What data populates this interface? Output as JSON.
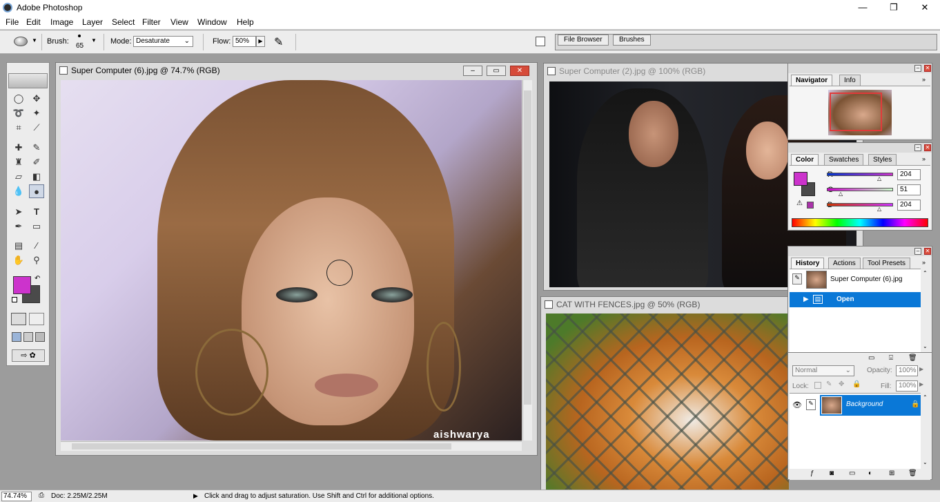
{
  "app": {
    "title": "Adobe Photoshop"
  },
  "window_controls": {
    "minimize": "—",
    "restore": "❐",
    "close": "✕"
  },
  "menu": [
    "File",
    "Edit",
    "Image",
    "Layer",
    "Select",
    "Filter",
    "View",
    "Window",
    "Help"
  ],
  "options": {
    "brush_label": "Brush:",
    "brush_size": "65",
    "mode_label": "Mode:",
    "mode_value": "Desaturate",
    "flow_label": "Flow:",
    "flow_value": "50%"
  },
  "dock_tabs": [
    "File Browser",
    "Brushes"
  ],
  "documents": [
    {
      "title": "Super Computer (6).jpg @ 74.7% (RGB)",
      "watermark": "aishwarya"
    },
    {
      "title": "Super Computer (2).jpg @ 100% (RGB)"
    },
    {
      "title": "CAT WITH FENCES.jpg @ 50% (RGB)"
    }
  ],
  "navigator": {
    "tabs": [
      "Navigator",
      "Info"
    ]
  },
  "color_panel": {
    "tabs": [
      "Color",
      "Swatches",
      "Styles"
    ],
    "r_label": "R",
    "r_value": "204",
    "g_label": "G",
    "g_value": "51",
    "b_label": "B",
    "b_value": "204",
    "foreground": "#cc33cc",
    "background_color": "#4a4a4a"
  },
  "history_panel": {
    "tabs": [
      "History",
      "Actions",
      "Tool Presets"
    ],
    "snapshot": "Super Computer (6).jpg",
    "items": [
      "Open"
    ]
  },
  "layers_panel": {
    "blend_mode": "Normal",
    "opacity_label": "Opacity:",
    "opacity_value": "100%",
    "lock_label": "Lock:",
    "fill_label": "Fill:",
    "fill_value": "100%",
    "layer_name": "Background"
  },
  "status": {
    "zoom": "74.74%",
    "doc": "Doc: 2.25M/2.25M",
    "hint": "Click and drag to adjust saturation.  Use Shift and Ctrl for additional options."
  },
  "colors": {
    "accent": "#0a78d7",
    "foreground_swatch": "#cc33cc"
  }
}
